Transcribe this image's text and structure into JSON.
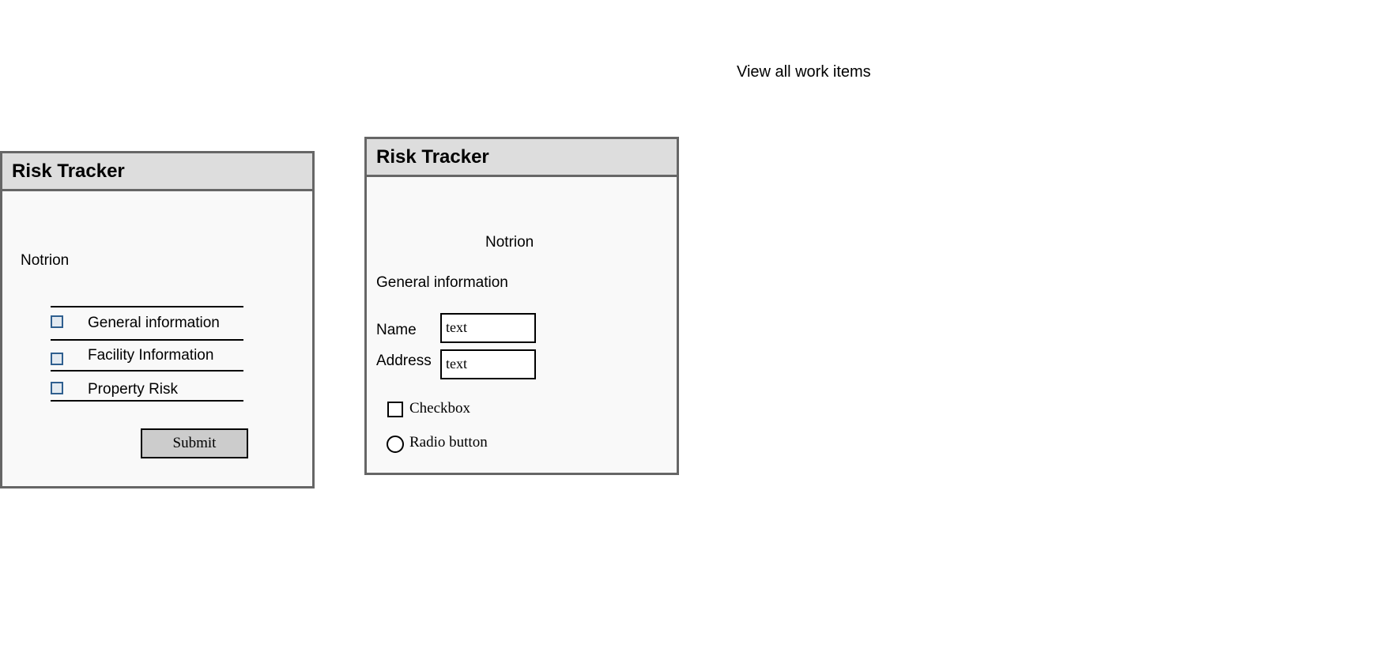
{
  "top_link": "View all work items",
  "window_left": {
    "title": "Risk Tracker",
    "heading": "Notrion",
    "items": [
      {
        "label": "General information"
      },
      {
        "label": "Facility Information"
      },
      {
        "label": "Property Risk"
      }
    ],
    "submit_label": "Submit"
  },
  "window_right": {
    "title": "Risk Tracker",
    "heading": "Notrion",
    "section": "General information",
    "name_label": "Name",
    "name_value": "text",
    "address_label": "Address",
    "address_value": "text",
    "checkbox_label": "Checkbox",
    "radio_label": "Radio button"
  }
}
